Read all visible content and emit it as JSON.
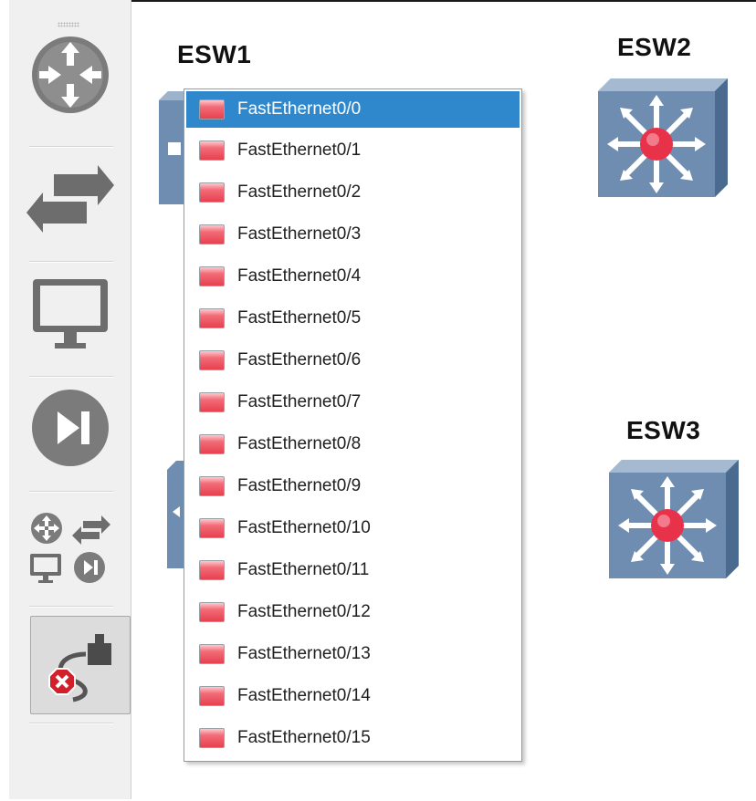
{
  "canvas": {
    "devices": [
      {
        "name": "ESW1"
      },
      {
        "name": "ESW2"
      },
      {
        "name": "ESW3"
      }
    ]
  },
  "toolbar": {
    "tools": [
      {
        "icon": "router-icon"
      },
      {
        "icon": "switch-icon"
      },
      {
        "icon": "end-device-icon"
      },
      {
        "icon": "security-device-icon"
      },
      {
        "icon": "all-devices-icon"
      },
      {
        "icon": "add-link-icon"
      }
    ],
    "active_tool": "add-link-icon"
  },
  "interface_menu": {
    "items": [
      {
        "label": "FastEthernet0/0",
        "selected": true
      },
      {
        "label": "FastEthernet0/1"
      },
      {
        "label": "FastEthernet0/2"
      },
      {
        "label": "FastEthernet0/3"
      },
      {
        "label": "FastEthernet0/4"
      },
      {
        "label": "FastEthernet0/5"
      },
      {
        "label": "FastEthernet0/6"
      },
      {
        "label": "FastEthernet0/7"
      },
      {
        "label": "FastEthernet0/8"
      },
      {
        "label": "FastEthernet0/9"
      },
      {
        "label": "FastEthernet0/10"
      },
      {
        "label": "FastEthernet0/11"
      },
      {
        "label": "FastEthernet0/12"
      },
      {
        "label": "FastEthernet0/13"
      },
      {
        "label": "FastEthernet0/14"
      },
      {
        "label": "FastEthernet0/15"
      }
    ]
  },
  "colors": {
    "selection": "#2f88cc",
    "port_down": "#e8404f",
    "switch_body": "#6f8db0"
  }
}
